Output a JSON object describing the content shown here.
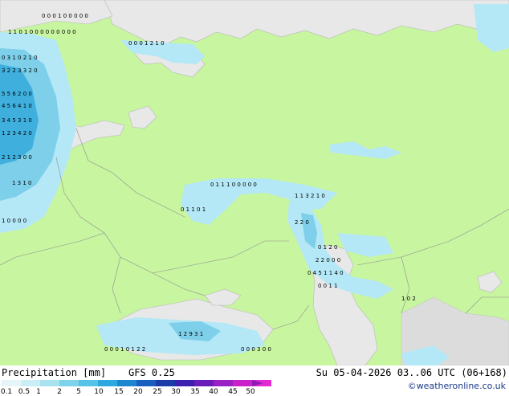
{
  "footer": {
    "title": "Precipitation [mm]",
    "model": "GFS 0.25",
    "valid": "Su 05-04-2026 03..06 UTC (06+168)",
    "credit": "©weatheronline.co.uk"
  },
  "legend": {
    "labels": [
      "0.1",
      "0.5",
      "1",
      "2",
      "5",
      "10",
      "15",
      "20",
      "25",
      "30",
      "35",
      "40",
      "45",
      "50"
    ],
    "colors": [
      "#e6f5f9",
      "#c9eef5",
      "#a9e3f0",
      "#7ed3ea",
      "#56c2e6",
      "#2fa7df",
      "#1c86d0",
      "#1a5fbf",
      "#1c3aa8",
      "#3a1fb0",
      "#6a1db8",
      "#9a22c4",
      "#c822c8",
      "#e22ad0"
    ]
  },
  "colors": {
    "land": "#c8f5a0",
    "sea": "#e8e8e8",
    "precip_light": "#b4e8f6",
    "precip_mid": "#7dcfea",
    "precip_heavy": "#3fb0de"
  },
  "map_values": [
    {
      "row": "0",
      "text": "0 0 0 1 0 0 0 0 0"
    },
    {
      "row": "1",
      "text": "1 1 0 1 0 0 0 0 0 0 0 0 0"
    },
    {
      "row": "2",
      "text": "0 0 0 1 2 1 0"
    },
    {
      "row": "3",
      "text": "0 3 1 0 2 1 0"
    },
    {
      "row": "4",
      "text": "3 2 2 3 3 2 0"
    },
    {
      "row": "5",
      "text": "5 5 6 2 0 0"
    },
    {
      "row": "6",
      "text": "4 5 6 4 1 0"
    },
    {
      "row": "7",
      "text": "3 4 5 3 1 0"
    },
    {
      "row": "8",
      "text": "1 2 3 4 2 0"
    },
    {
      "row": "9",
      "text": "2 1 2 3 0 0"
    },
    {
      "row": "10",
      "text": "1 3 1 0"
    },
    {
      "row": "11",
      "text": "0 1 1 1 0 0 0 0 0"
    },
    {
      "row": "12",
      "text": "1 1 3 2 1 0"
    },
    {
      "row": "13",
      "text": "0 1 1 0 1"
    },
    {
      "row": "14",
      "text": "1 0 0 0 0"
    },
    {
      "row": "15",
      "text": "2 2 0"
    },
    {
      "row": "16",
      "text": "0 1 2 0"
    },
    {
      "row": "17",
      "text": "2 2 0 0 0"
    },
    {
      "row": "18",
      "text": "0 4 5 1 1 4 0"
    },
    {
      "row": "19",
      "text": "0 0 1 1"
    },
    {
      "row": "20",
      "text": "1 0 2"
    },
    {
      "row": "21",
      "text": "1 2 9 3 1"
    },
    {
      "row": "22",
      "text": "0 0 0 1 0 1 2 2"
    },
    {
      "row": "23",
      "text": "0 0 0 3 0 0"
    }
  ]
}
